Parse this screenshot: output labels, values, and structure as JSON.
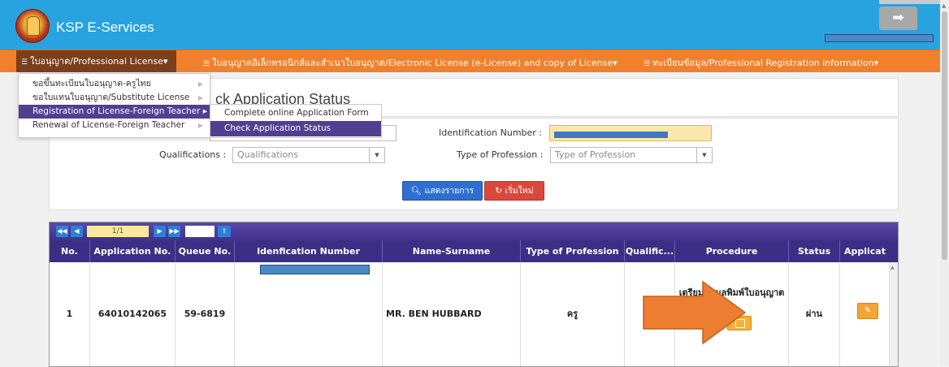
{
  "header": {
    "app_title": "KSP E-Services"
  },
  "nav": {
    "items": [
      "ใบอนุญาต/Professional License▾",
      "ใบอนุญาตอิเล็กทรอนิกส์และสำเนาใบอนุญาต/Electronic License (e-License) and copy of License▾",
      "ทะเบียนข้อมูล/Professional Registration information▾"
    ]
  },
  "dropdown": {
    "items": [
      "ขอขึ้นทะเบียนใบอนุญาต-ครูไทย",
      "ขอใบแทนใบอนุญาต/Substitute License",
      "Registration of License-Foreign Teacher ▸",
      "Renewal of License-Foreign Teacher"
    ],
    "submenu": [
      "Complete online Application Form",
      "Check Application Status"
    ]
  },
  "page": {
    "title": "ck Application Status"
  },
  "search": {
    "id_label": "Identification Number :",
    "qual_label": "Qualifications :",
    "qual_placeholder": "Qualifications",
    "prof_label": "Type of Profession :",
    "prof_placeholder": "Type of Profession",
    "show_button": "แสดงรายการ",
    "reset_button": "เริ่มใหม่"
  },
  "pager": {
    "page": "1/1"
  },
  "table": {
    "headers": [
      "No.",
      "Application No.",
      "Queue No.",
      "Idenfication Number",
      "Name-Surname",
      "Type of Profession",
      "Qualific...",
      "Procedure",
      "Status",
      "Applicat"
    ],
    "row": {
      "no": "1",
      "application_no": "64010142065",
      "queue_no": "59-6819",
      "name": "MR. BEN HUBBARD",
      "profession": "ครู",
      "procedure": "เตรียมข้อมูลพิมพ์ใบอนุญาต",
      "status": "ผ่าน"
    }
  },
  "colors": {
    "header_blue": "#29a3e0",
    "nav_orange": "#f0802b",
    "menu_purple": "#523f92",
    "arrow_orange": "#ed7d31"
  }
}
